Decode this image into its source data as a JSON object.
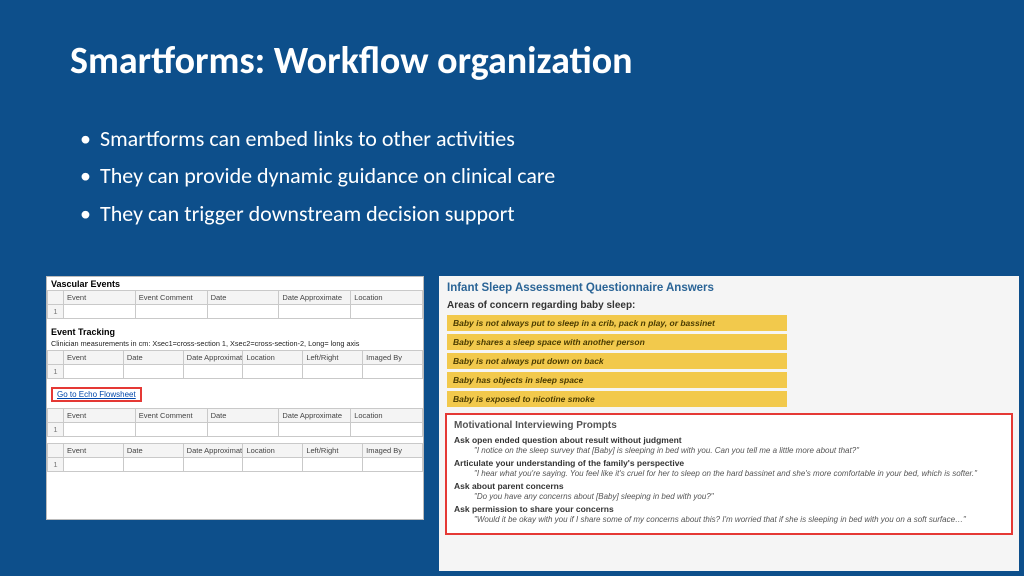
{
  "title": "Smartforms: Workflow organization",
  "bullets": [
    "Smartforms can embed links to other activities",
    "They can provide dynamic guidance on clinical care",
    "They can trigger downstream decision support"
  ],
  "left": {
    "vascular_title": "Vascular Events",
    "vascular_cols": [
      "Event",
      "Event Comment",
      "Date",
      "Date Approximate",
      "Location"
    ],
    "tracking_title": "Event Tracking",
    "tracking_note": "Clinician measurements in cm: Xsec1=cross-section 1, Xsec2=cross-section-2, Long= long axis",
    "tracking_cols": [
      "Event",
      "Date",
      "Date Approximate",
      "Location",
      "Left/Right",
      "Imaged By"
    ],
    "flowsheet_link": "Go to Echo Flowsheet",
    "events2_cols": [
      "Event",
      "Event Comment",
      "Date",
      "Date Approximate",
      "Location"
    ],
    "track2_cols": [
      "Event",
      "Date",
      "Date Approximate",
      "Location",
      "Left/Right",
      "Imaged By"
    ]
  },
  "right": {
    "qa_title": "Infant Sleep Assessment Questionnaire Answers",
    "areas_title": "Areas of concern regarding baby sleep:",
    "concerns": [
      "Baby is not always put to sleep in a crib, pack n play, or bassinet",
      "Baby shares a sleep space with another person",
      "Baby is not always put down on back",
      "Baby has objects in sleep space",
      "Baby is exposed to nicotine smoke"
    ],
    "mi_title": "Motivational Interviewing Prompts",
    "prompts": [
      {
        "h": "Ask open ended question about result without judgment",
        "q": "\"I notice on the sleep survey that [Baby] is sleeping in bed with you. Can you tell me a little more about that?\""
      },
      {
        "h": "Articulate your understanding of the family's perspective",
        "q": "\"I hear what you're saying. You feel like it's cruel for her to sleep on the hard bassinet and she's more comfortable in your bed, which is softer.\""
      },
      {
        "h": "Ask about parent concerns",
        "q": "\"Do you have any concerns about [Baby] sleeping in bed with you?\""
      },
      {
        "h": "Ask permission to share your concerns",
        "q": "\"Would it be okay with you if I share some of my concerns about this? I'm worried that if she is sleeping in bed with you on a soft surface…\""
      }
    ]
  }
}
